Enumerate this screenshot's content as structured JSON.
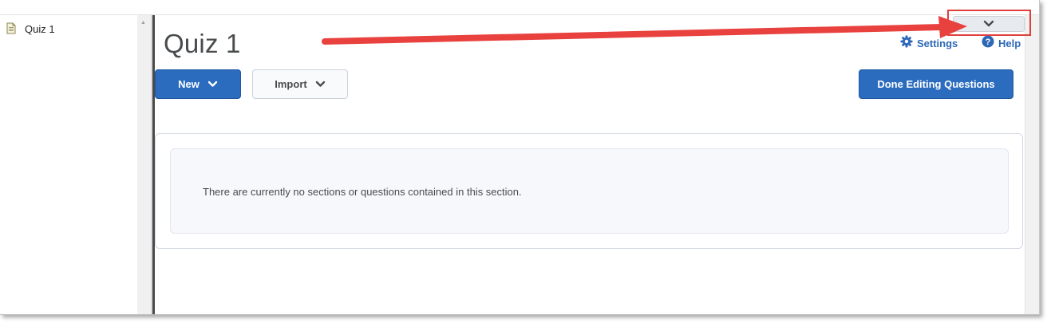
{
  "tree": {
    "item_label": "Quiz 1",
    "item_icon": "document-icon"
  },
  "page": {
    "title": "Quiz 1"
  },
  "header_links": {
    "settings_label": "Settings",
    "settings_icon": "gear-icon",
    "help_label": "Help",
    "help_icon": "help-circle-icon"
  },
  "toolbar": {
    "new_label": "New",
    "import_label": "Import",
    "done_label": "Done Editing Questions"
  },
  "content": {
    "empty_message": "There are currently no sections or questions contained in this section."
  },
  "colors": {
    "primary_button": "#2b6cbf",
    "link_blue": "#2c68b6",
    "annotation_red": "#e0403d"
  }
}
